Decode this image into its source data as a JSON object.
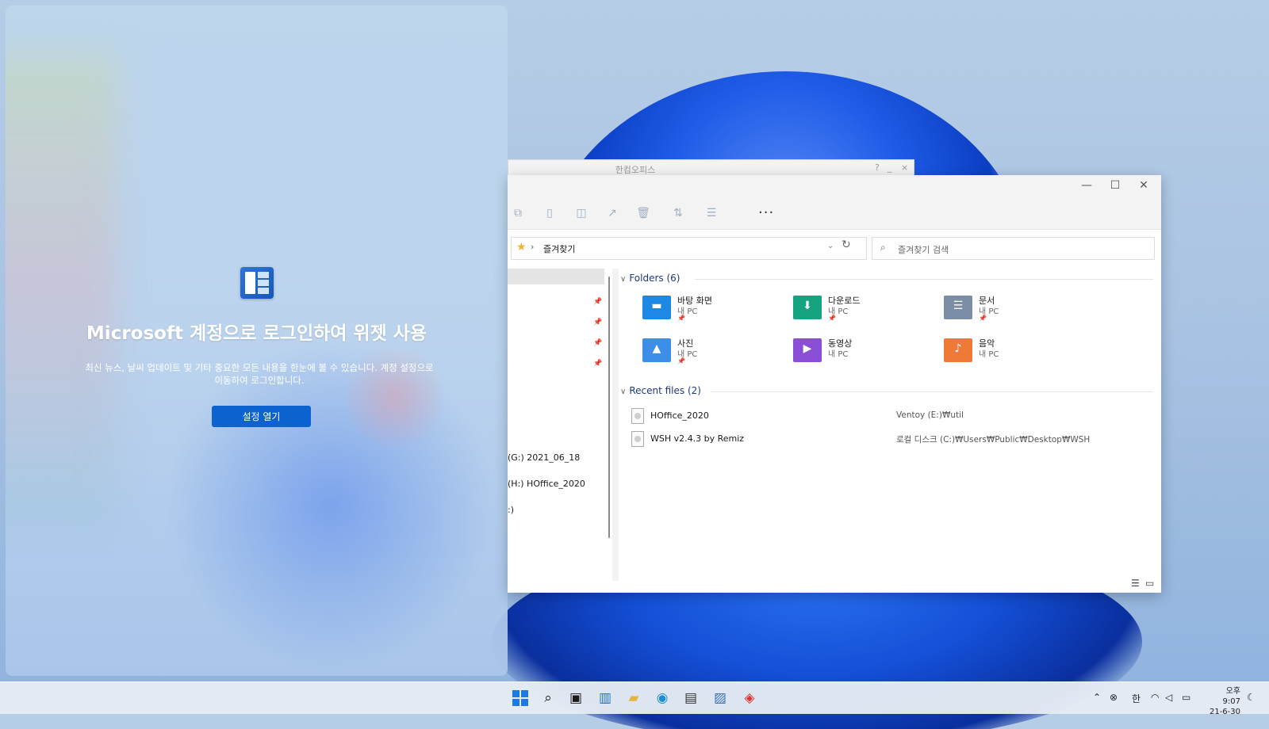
{
  "widgets": {
    "title": "Microsoft 계정으로 로그인하여 위젯 사용",
    "description": "최신 뉴스, 날씨 업데이트 및 기타 중요한 모든 내용을 한눈에 볼 수 있습니다. 계정 설정으로 이동하여 로그인합니다.",
    "button_label": "설정 열기"
  },
  "hancom": {
    "title": "한컴오피스",
    "help": "?",
    "minimize": "_",
    "close": "×"
  },
  "explorer": {
    "window_controls": {
      "minimize": "—",
      "maximize": "☐",
      "close": "✕"
    },
    "toolbar": {
      "more": "···"
    },
    "address": {
      "location": "즐겨찾기"
    },
    "search": {
      "placeholder": "즐겨찾기 검색"
    },
    "nav": {
      "drives": [
        "(G:) 2021_06_18",
        "(H:) HOffice_2020",
        ":)"
      ]
    },
    "folders_header": "Folders (6)",
    "folders": [
      {
        "name": "바탕 화면",
        "location": "내 PC",
        "color": "#1e88e5",
        "icon": "desktop-folder"
      },
      {
        "name": "다운로드",
        "location": "내 PC",
        "color": "#16a37f",
        "icon": "download-folder"
      },
      {
        "name": "문서",
        "location": "내 PC",
        "color": "#7a8ea8",
        "icon": "documents-folder"
      },
      {
        "name": "사진",
        "location": "내 PC",
        "color": "#3d8ee8",
        "icon": "pictures-folder"
      },
      {
        "name": "동영상",
        "location": "내 PC",
        "color": "#8a4fd6",
        "icon": "videos-folder"
      },
      {
        "name": "음악",
        "location": "내 PC",
        "color": "#ee7a3a",
        "icon": "music-folder"
      }
    ],
    "recent_header": "Recent files (2)",
    "recent": [
      {
        "name": "HOffice_2020",
        "path": "Ventoy (E:)₩util"
      },
      {
        "name": "WSH v2.4.3 by Remiz",
        "path": "로컬 디스크 (C:)₩Users₩Public₩Desktop₩WSH"
      }
    ]
  },
  "taskbar": {
    "ime": "한",
    "time": "오후 9:07",
    "date": "21-6-30"
  }
}
